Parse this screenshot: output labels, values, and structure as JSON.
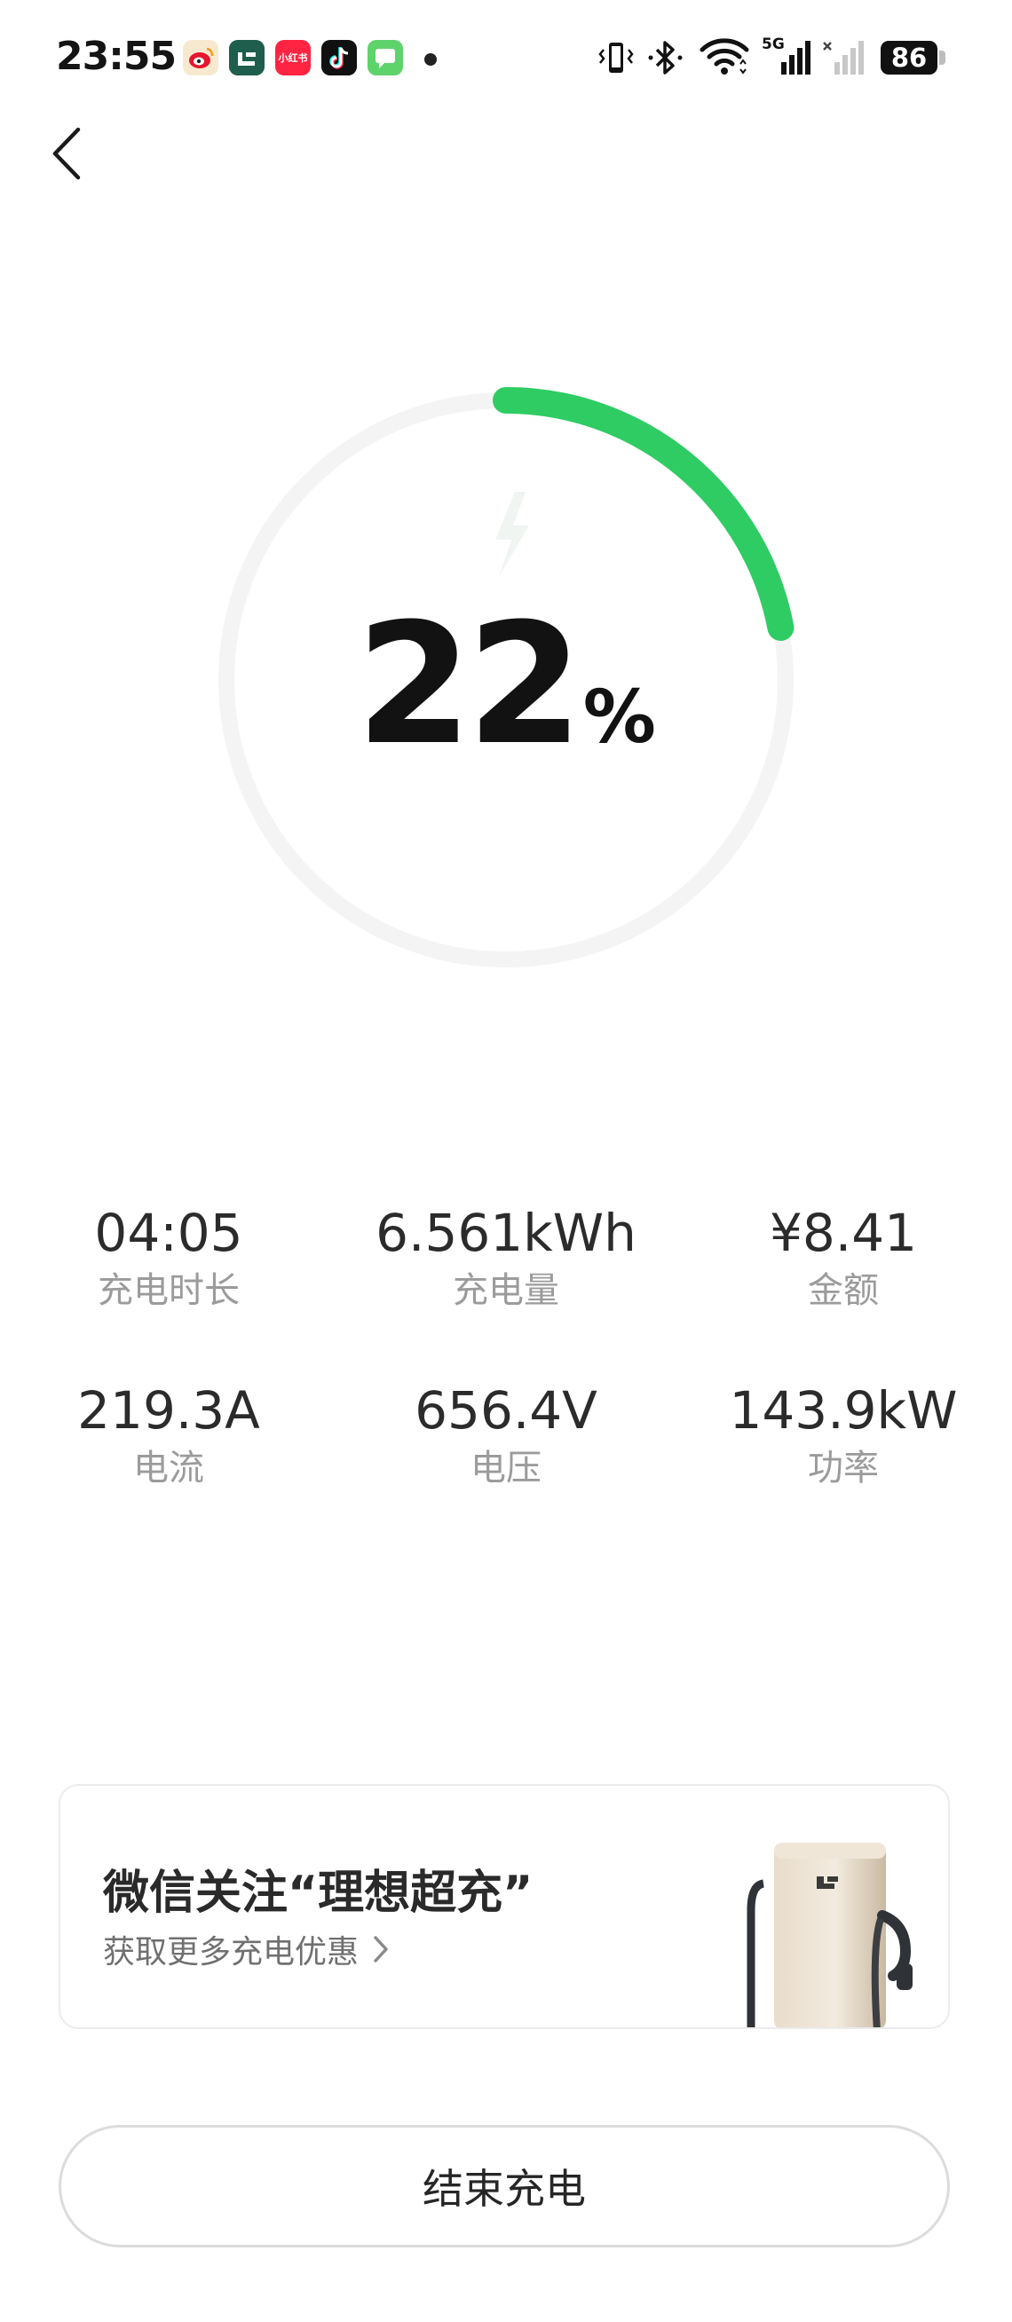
{
  "status_bar": {
    "time": "23:55",
    "battery": "86",
    "network": "5G",
    "app_icons": [
      "weibo-icon",
      "li-auto-icon",
      "xiaohongshu-icon",
      "douyin-icon",
      "messages-icon"
    ],
    "app_icon_labels": {
      "xiaohongshu": "小红书"
    }
  },
  "charging": {
    "percent": "22",
    "percent_unit": "%",
    "progress": 0.22
  },
  "stats": [
    {
      "value": "04:05",
      "label": "充电时长"
    },
    {
      "value": "6.561kWh",
      "label": "充电量"
    },
    {
      "value": "¥8.41",
      "label": "金额"
    },
    {
      "value": "219.3A",
      "label": "电流"
    },
    {
      "value": "656.4V",
      "label": "电压"
    },
    {
      "value": "143.9kW",
      "label": "功率"
    }
  ],
  "promo": {
    "title": "微信关注“理想超充”",
    "subtitle": "获取更多充电优惠"
  },
  "end_button": {
    "label": "结束充电"
  },
  "colors": {
    "accent": "#2ecc63",
    "ring_track": "#f4f4f4",
    "stat_label": "#9b9b9b"
  }
}
